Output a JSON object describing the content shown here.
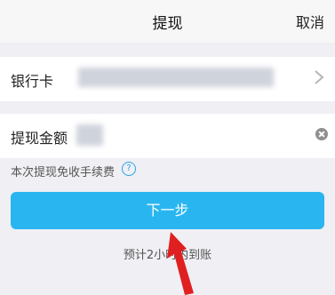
{
  "header": {
    "title": "提现",
    "cancel_label": "取消"
  },
  "bank_row": {
    "label": "银行卡",
    "value_redacted": true
  },
  "amount_row": {
    "label": "提现金额",
    "value_redacted": true
  },
  "fee_note": "本次提现免收手续费",
  "help_glyph": "?",
  "next_button": "下一步",
  "eta": "预计2小时内到账",
  "colors": {
    "background": "#efeff4",
    "accent": "#29b6f0",
    "help": "#2aa4e8",
    "annotation_arrow": "#e02020"
  },
  "icons": [
    "chevron-right-icon",
    "clear-icon",
    "help-icon",
    "annotation-arrow"
  ]
}
